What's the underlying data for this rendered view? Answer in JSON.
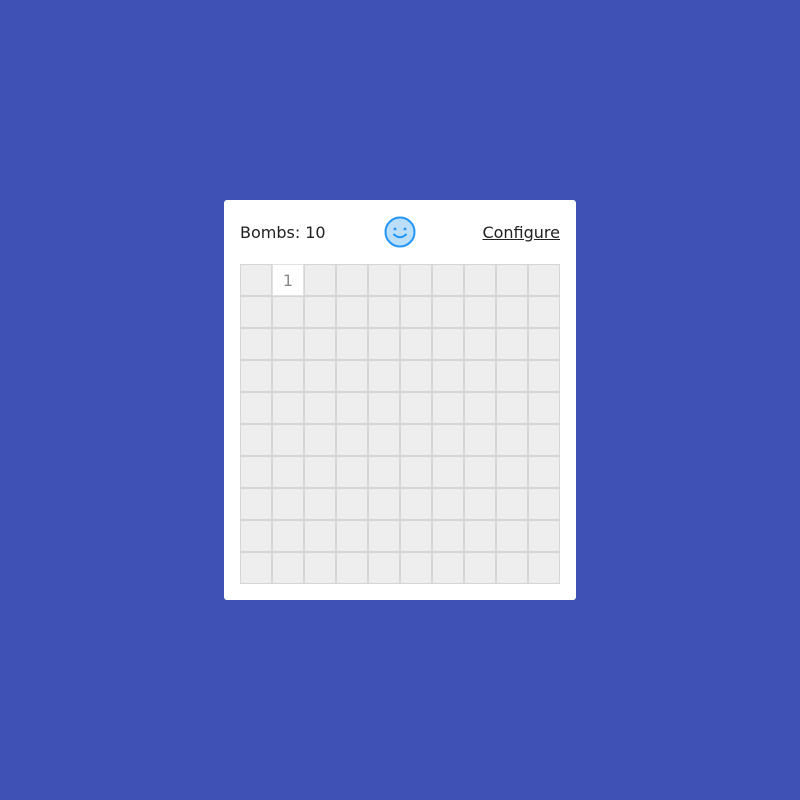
{
  "header": {
    "bombs_label": "Bombs:",
    "bombs_count": "10",
    "reset_icon": "smiley-face-icon",
    "configure_label": "Configure"
  },
  "board": {
    "rows": 10,
    "cols": 10,
    "revealed": [
      {
        "row": 0,
        "col": 1,
        "label": "1"
      }
    ]
  },
  "colors": {
    "background": "#3f51b5",
    "panel": "#ffffff",
    "hidden_cell": "#eeeeee",
    "revealed_cell": "#ffffff",
    "smiley_stroke": "#2196f3",
    "smiley_fill": "#bbdefb"
  }
}
